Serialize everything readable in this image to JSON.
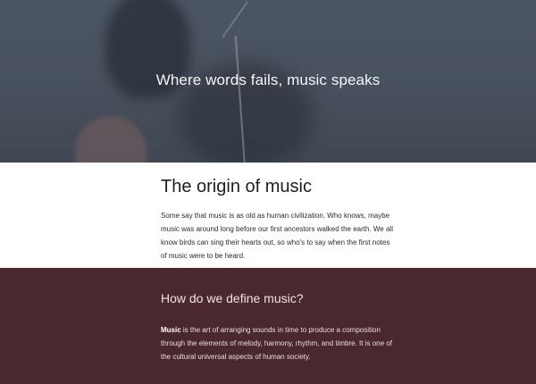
{
  "hero": {
    "title": "Where words fails, music speaks"
  },
  "origin": {
    "heading": "The origin of music",
    "body": "Some say that music is as old as human civilization. Who knows, maybe music was around long before our first ancestors walked the earth. We all know birds can sing their hearts out, so who's to say when the first notes of music were to be heard."
  },
  "define": {
    "heading": "How do we define music?",
    "term": "Music",
    "body": " is the art of arranging sounds in time to produce a composition through the elements of melody, harmony, rhythm, and timbre. It is one of the cultural universal aspects of human society."
  },
  "colors": {
    "hero_bg": "#4a5360",
    "define_bg": "#4a2830"
  }
}
